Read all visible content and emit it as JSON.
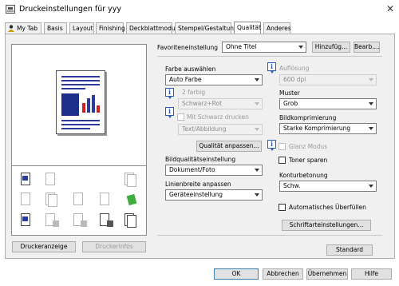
{
  "window": {
    "title": "Druckeinstellungen für yyy"
  },
  "tabs": [
    "My Tab",
    "Basis",
    "Layout",
    "Finishing",
    "Deckblattmodus",
    "Stempel/Gestaltung",
    "Qualität",
    "Anderes"
  ],
  "favorites": {
    "label": "Favoriteneinstellung",
    "value": "Ohne Titel",
    "add_button": "Hinzufüg...",
    "edit_button": "Bearb...."
  },
  "left_panel": {
    "printer_view_button": "Druckeranzeige",
    "printer_info_button": "Druckerinfos"
  },
  "color_select": {
    "label": "Farbe auswählen",
    "value": "Auto Farbe"
  },
  "two_color": {
    "label": "2 farbig",
    "value": "Schwarz+Rot"
  },
  "black_print": {
    "label": "Mit Schwarz drucken",
    "value": "Text/Abbildung"
  },
  "quality_adjust_button": "Qualität anpassen...",
  "image_quality": {
    "label": "Bildqualitätseinstellung",
    "value": "Dokument/Foto"
  },
  "line_width": {
    "label": "Linienbreite anpassen",
    "value": "Geräteeinstellung"
  },
  "resolution": {
    "label": "Auflösung",
    "value": "600 dpi"
  },
  "pattern": {
    "label": "Muster",
    "value": "Grob"
  },
  "compression": {
    "label": "Bildkomprimierung",
    "value": "Starke Komprimierung"
  },
  "gloss_mode": {
    "label": "Glanz Modus"
  },
  "toner_save": {
    "label": "Toner sparen"
  },
  "contour": {
    "label": "Konturbetonung",
    "value": "Schw."
  },
  "auto_trapping": {
    "label": "Automatisches Überfüllen"
  },
  "font_settings_button": "Schriftarteinstellungen...",
  "standard_button": "Standard",
  "footer": {
    "ok": "OK",
    "cancel": "Abbrechen",
    "apply": "Übernehmen",
    "help": "Hilfe"
  }
}
